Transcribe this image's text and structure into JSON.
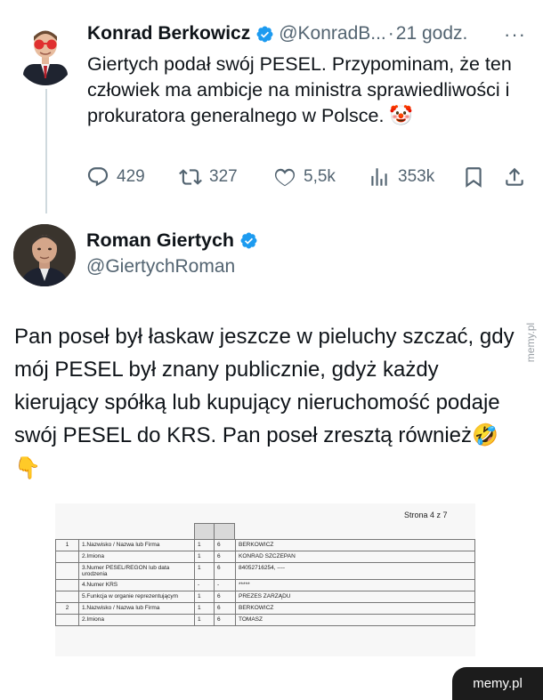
{
  "tweet1": {
    "author_name": "Konrad Berkowicz",
    "handle": "@KonradB...",
    "dot": "·",
    "time": "21 godz.",
    "more": "···",
    "text": "Giertych podał swój PESEL. Przypominam, że ten człowiek ma ambicje na ministra sprawiedliwości i prokuratora generalnego w Polsce. 🤡",
    "replies": "429",
    "reposts": "327",
    "likes": "5,5k",
    "views": "353k"
  },
  "tweet2": {
    "author_name": "Roman Giertych",
    "handle": "@GiertychRoman",
    "text": "Pan poseł był łaskaw jeszcze w pieluchy szczać, gdy mój PESEL był znany publicznie, gdyż każdy kierujący spółką lub kupujący nieruchomość podaje swój PESEL do KRS. Pan poseł zresztą również🤣 👇"
  },
  "document": {
    "page_label": "Strona 4 z 7",
    "rows": [
      {
        "lp": "1",
        "field": "1.Nazwisko / Nazwa lub Firma",
        "a": "1",
        "b": "6",
        "value": "BERKOWICZ"
      },
      {
        "lp": "",
        "field": "2.Imiona",
        "a": "1",
        "b": "6",
        "value": "KONRAD SZCZEPAN"
      },
      {
        "lp": "",
        "field": "3.Numer PESEL/REGON lub data urodzenia",
        "a": "1",
        "b": "6",
        "value": "84052716254, ----"
      },
      {
        "lp": "",
        "field": "4.Numer KRS",
        "a": "-",
        "b": "-",
        "value": "*****"
      },
      {
        "lp": "",
        "field": "5.Funkcja w organie reprezentującym",
        "a": "1",
        "b": "6",
        "value": "PREZES ZARZĄDU"
      },
      {
        "lp": "2",
        "field": "1.Nazwisko / Nazwa lub Firma",
        "a": "1",
        "b": "6",
        "value": "BERKOWICZ"
      },
      {
        "lp": "",
        "field": "2.Imiona",
        "a": "1",
        "b": "6",
        "value": "TOMASZ"
      }
    ]
  },
  "watermark": {
    "side": "memy.pl",
    "badge": "memy.pl"
  },
  "colors": {
    "text": "#0f1419",
    "secondary": "#536471",
    "verified": "#1d9bf0",
    "thread_line": "#cfd9de"
  }
}
